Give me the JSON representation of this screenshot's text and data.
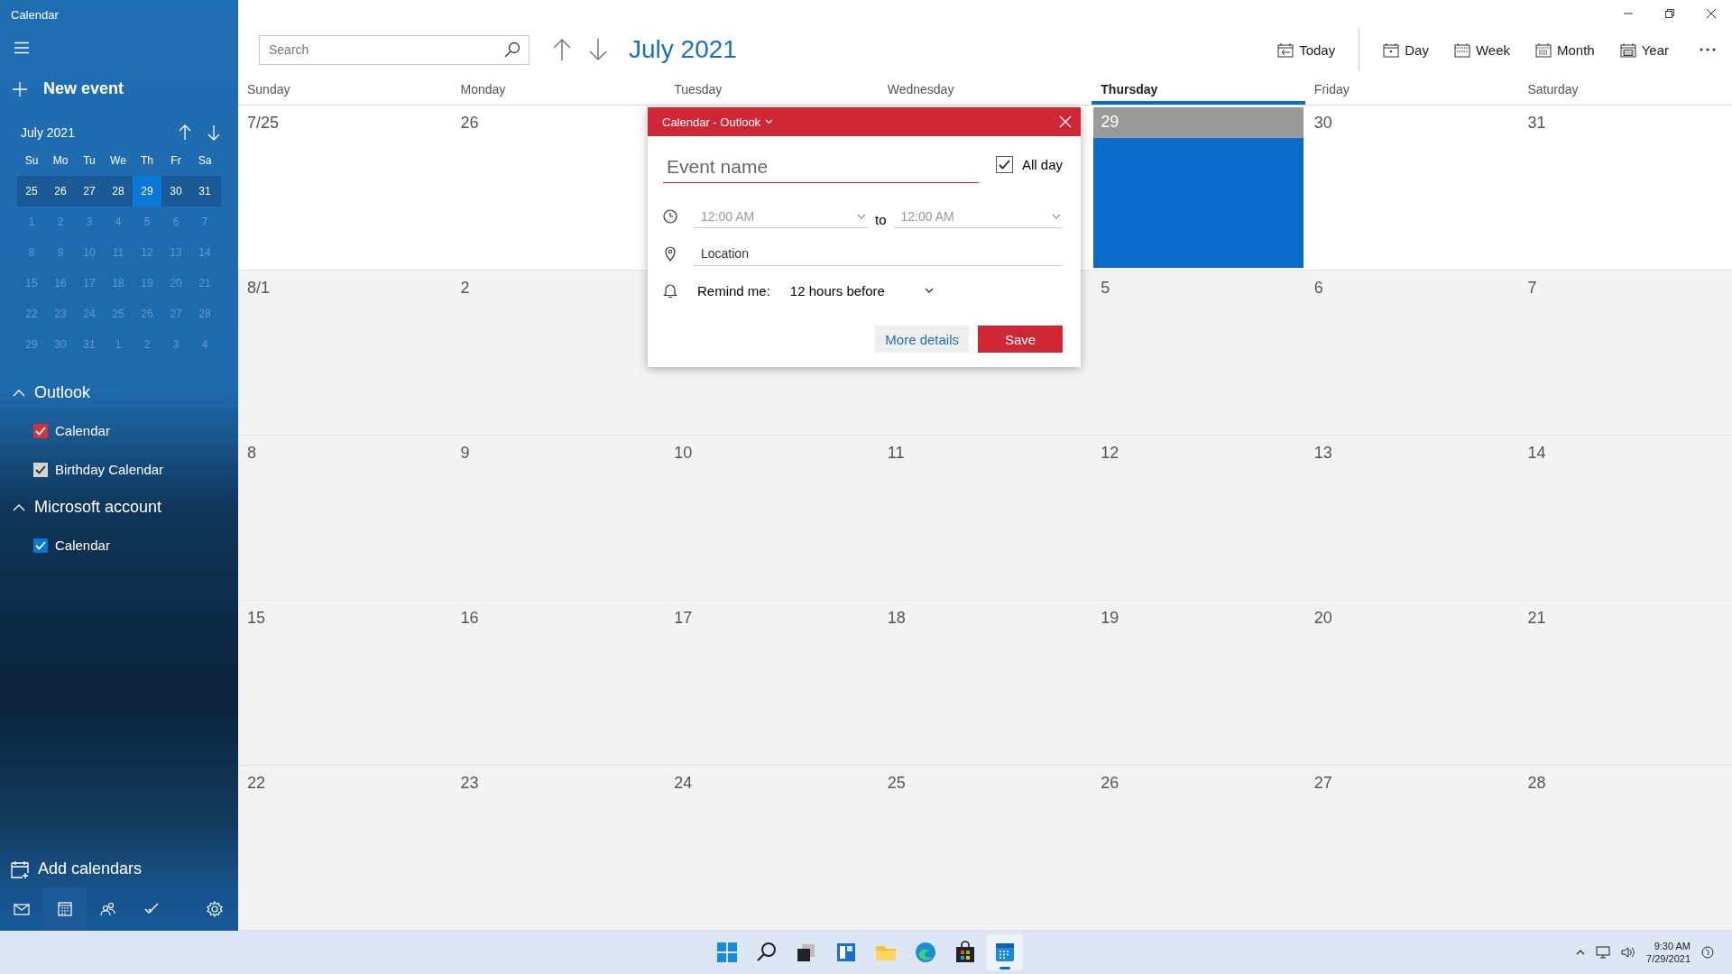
{
  "window": {
    "title": "Calendar"
  },
  "sidebar": {
    "new_event": "New event",
    "mini_calendar": {
      "title": "July 2021",
      "weekdays": [
        "Su",
        "Mo",
        "Tu",
        "We",
        "Th",
        "Fr",
        "Sa"
      ],
      "weeks": [
        {
          "current": true,
          "days": [
            {
              "label": "25",
              "selected": false,
              "other_month": false
            },
            {
              "label": "26",
              "selected": false,
              "other_month": false
            },
            {
              "label": "27",
              "selected": false,
              "other_month": false
            },
            {
              "label": "28",
              "selected": false,
              "other_month": false
            },
            {
              "label": "29",
              "selected": true,
              "other_month": false
            },
            {
              "label": "30",
              "selected": false,
              "other_month": false
            },
            {
              "label": "31",
              "selected": false,
              "other_month": false
            }
          ]
        },
        {
          "current": false,
          "days": [
            {
              "label": "1",
              "selected": false,
              "other_month": true
            },
            {
              "label": "2",
              "selected": false,
              "other_month": true
            },
            {
              "label": "3",
              "selected": false,
              "other_month": true
            },
            {
              "label": "4",
              "selected": false,
              "other_month": true
            },
            {
              "label": "5",
              "selected": false,
              "other_month": true
            },
            {
              "label": "6",
              "selected": false,
              "other_month": true
            },
            {
              "label": "7",
              "selected": false,
              "other_month": true
            }
          ]
        },
        {
          "current": false,
          "days": [
            {
              "label": "8",
              "selected": false,
              "other_month": true
            },
            {
              "label": "9",
              "selected": false,
              "other_month": true
            },
            {
              "label": "10",
              "selected": false,
              "other_month": true
            },
            {
              "label": "11",
              "selected": false,
              "other_month": true
            },
            {
              "label": "12",
              "selected": false,
              "other_month": true
            },
            {
              "label": "13",
              "selected": false,
              "other_month": true
            },
            {
              "label": "14",
              "selected": false,
              "other_month": true
            }
          ]
        },
        {
          "current": false,
          "days": [
            {
              "label": "15",
              "selected": false,
              "other_month": true
            },
            {
              "label": "16",
              "selected": false,
              "other_month": true
            },
            {
              "label": "17",
              "selected": false,
              "other_month": true
            },
            {
              "label": "18",
              "selected": false,
              "other_month": true
            },
            {
              "label": "19",
              "selected": false,
              "other_month": true
            },
            {
              "label": "20",
              "selected": false,
              "other_month": true
            },
            {
              "label": "21",
              "selected": false,
              "other_month": true
            }
          ]
        },
        {
          "current": false,
          "days": [
            {
              "label": "22",
              "selected": false,
              "other_month": true
            },
            {
              "label": "23",
              "selected": false,
              "other_month": true
            },
            {
              "label": "24",
              "selected": false,
              "other_month": true
            },
            {
              "label": "25",
              "selected": false,
              "other_month": true
            },
            {
              "label": "26",
              "selected": false,
              "other_month": true
            },
            {
              "label": "27",
              "selected": false,
              "other_month": true
            },
            {
              "label": "28",
              "selected": false,
              "other_month": true
            }
          ]
        },
        {
          "current": false,
          "days": [
            {
              "label": "29",
              "selected": false,
              "other_month": true
            },
            {
              "label": "30",
              "selected": false,
              "other_month": true
            },
            {
              "label": "31",
              "selected": false,
              "other_month": true
            },
            {
              "label": "1",
              "selected": false,
              "other_month": true
            },
            {
              "label": "2",
              "selected": false,
              "other_month": true
            },
            {
              "label": "3",
              "selected": false,
              "other_month": true
            },
            {
              "label": "4",
              "selected": false,
              "other_month": true
            }
          ]
        }
      ]
    },
    "accounts": [
      {
        "name": "Outlook",
        "expanded": true,
        "calendars": [
          {
            "name": "Calendar",
            "checked": true,
            "color": "#d13438"
          },
          {
            "name": "Birthday Calendar",
            "checked": true,
            "color": "#d4d4d4"
          }
        ]
      },
      {
        "name": "Microsoft account",
        "expanded": true,
        "calendars": [
          {
            "name": "Calendar",
            "checked": true,
            "color": "#0078d4"
          }
        ]
      }
    ],
    "add_calendars": "Add calendars",
    "nav": [
      {
        "kind": "mail",
        "selected": false
      },
      {
        "kind": "calendar",
        "selected": true
      },
      {
        "kind": "people",
        "selected": false
      },
      {
        "kind": "todo",
        "selected": false
      },
      {
        "kind": "settings",
        "selected": false
      }
    ]
  },
  "toolbar": {
    "search": {
      "placeholder": "Search"
    },
    "month_title": "July 2021",
    "views": [
      {
        "kind": "today",
        "label": "Today"
      },
      {
        "kind": "day",
        "label": "Day"
      },
      {
        "kind": "week",
        "label": "Week"
      },
      {
        "kind": "month",
        "label": "Month"
      },
      {
        "kind": "year",
        "label": "Year"
      }
    ]
  },
  "grid": {
    "weekdays": [
      {
        "label": "Sunday",
        "today": false
      },
      {
        "label": "Monday",
        "today": false
      },
      {
        "label": "Tuesday",
        "today": false
      },
      {
        "label": "Wednesday",
        "today": false
      },
      {
        "label": "Thursday",
        "today": true
      },
      {
        "label": "Friday",
        "today": false
      },
      {
        "label": "Saturday",
        "today": false
      }
    ],
    "weeks": [
      {
        "days": [
          {
            "label": "7/25",
            "selected": false
          },
          {
            "label": "26",
            "selected": false
          },
          {
            "label": "29",
            "selected": true
          },
          {
            "label": "30",
            "selected": false
          },
          {
            "label": "31",
            "selected": false
          }
        ]
      },
      {
        "days": [
          {
            "label": "8/1",
            "selected": false
          },
          {
            "label": "2",
            "selected": false
          },
          {
            "label": "5",
            "selected": false
          },
          {
            "label": "6",
            "selected": false
          },
          {
            "label": "7",
            "selected": false
          }
        ]
      },
      {
        "days": [
          {
            "label": "8",
            "selected": false
          },
          {
            "label": "9",
            "selected": false
          },
          {
            "label": "10",
            "selected": false
          },
          {
            "label": "11",
            "selected": false
          },
          {
            "label": "12",
            "selected": false
          },
          {
            "label": "13",
            "selected": false
          },
          {
            "label": "14",
            "selected": false
          }
        ]
      },
      {
        "days": [
          {
            "label": "15",
            "selected": false
          },
          {
            "label": "16",
            "selected": false
          },
          {
            "label": "17",
            "selected": false
          },
          {
            "label": "18",
            "selected": false
          },
          {
            "label": "19",
            "selected": false
          },
          {
            "label": "20",
            "selected": false
          },
          {
            "label": "21",
            "selected": false
          }
        ]
      },
      {
        "days": [
          {
            "label": "22",
            "selected": false
          },
          {
            "label": "23",
            "selected": false
          },
          {
            "label": "24",
            "selected": false
          },
          {
            "label": "25",
            "selected": false
          },
          {
            "label": "26",
            "selected": false
          },
          {
            "label": "27",
            "selected": false
          },
          {
            "label": "28",
            "selected": false
          }
        ]
      }
    ]
  },
  "popup": {
    "calendar": "Calendar - Outlook",
    "event_name": {
      "placeholder": "Event name"
    },
    "all_day": {
      "label": "All day",
      "checked": true
    },
    "start": {
      "value": "12:00 AM",
      "disabled": true
    },
    "to": "to",
    "end": {
      "value": "12:00 AM",
      "disabled": true
    },
    "location": {
      "placeholder": "Location"
    },
    "reminder": {
      "label": "Remind me:",
      "value": "12 hours before"
    },
    "buttons": [
      {
        "kind": "secondary",
        "label": "More details"
      },
      {
        "kind": "primary",
        "label": "Save"
      }
    ]
  },
  "taskbar": {
    "apps": [
      {
        "kind": "start",
        "selected": false
      },
      {
        "kind": "search",
        "selected": false
      },
      {
        "kind": "taskview",
        "selected": false
      },
      {
        "kind": "widgets",
        "selected": false
      },
      {
        "kind": "explorer",
        "selected": false
      },
      {
        "kind": "browser",
        "selected": false
      },
      {
        "kind": "store",
        "selected": false
      },
      {
        "kind": "calendar",
        "selected": true
      }
    ],
    "clock": {
      "time": "9:30 AM",
      "date": "7/29/2021"
    }
  }
}
